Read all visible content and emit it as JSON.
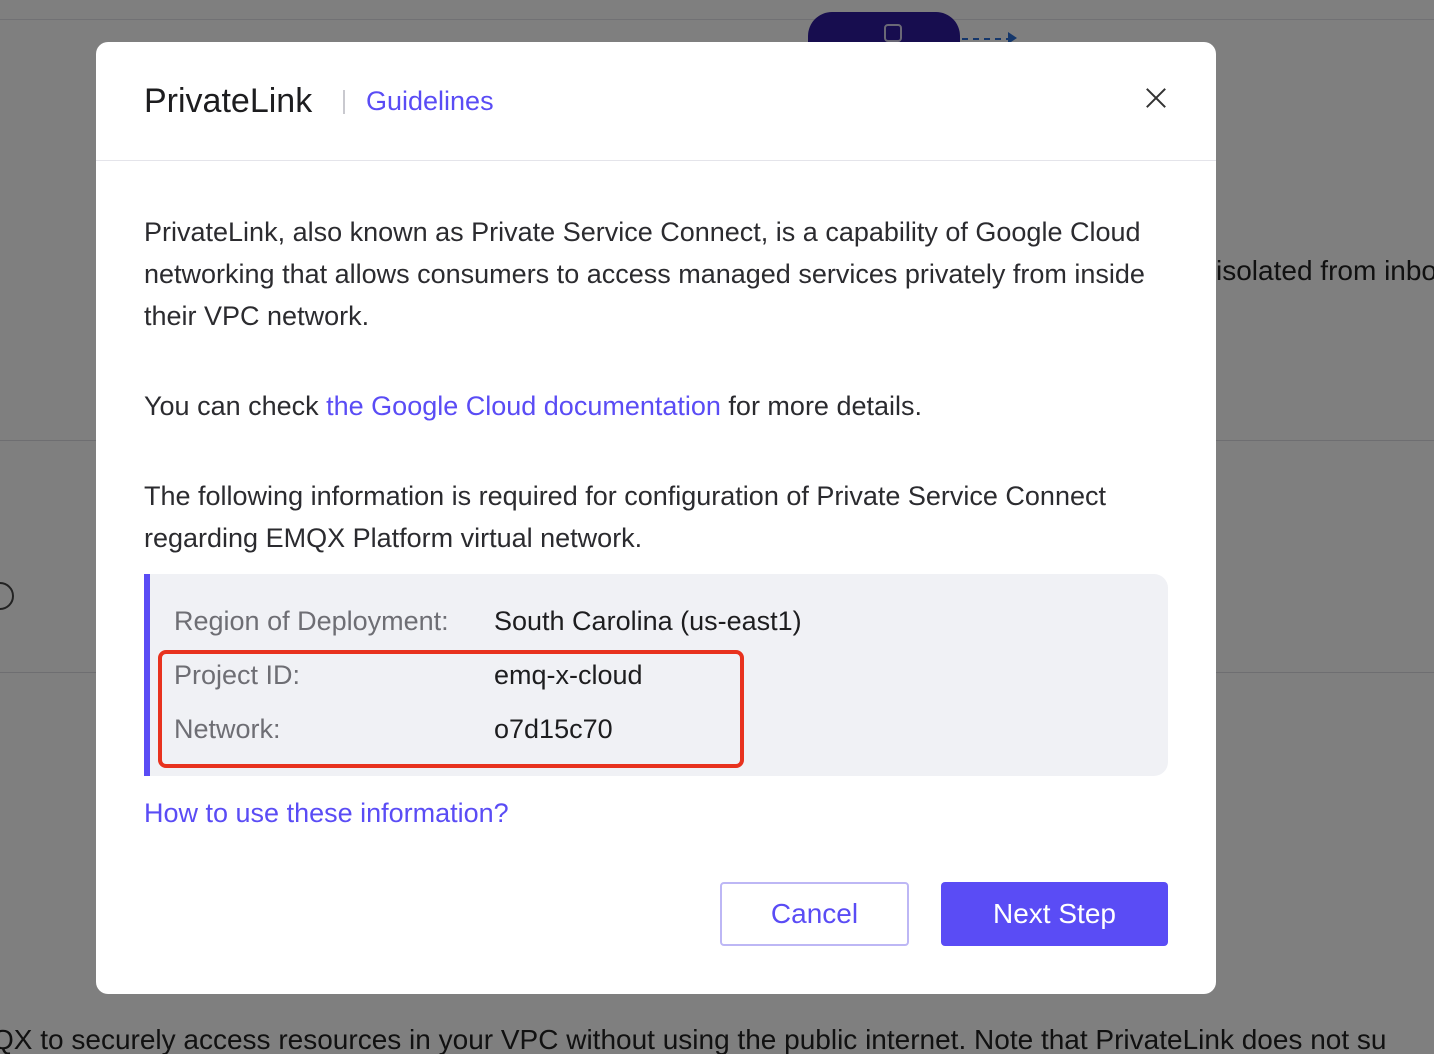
{
  "background": {
    "right_text": "isolated from inbo",
    "bottom_text": "QX to securely access resources in your VPC without using the public internet. Note that PrivateLink does not su"
  },
  "dialog": {
    "title": "PrivateLink",
    "guidelines_label": "Guidelines",
    "intro_text": "PrivateLink, also known as Private Service Connect, is a capability of Google Cloud networking that allows consumers to access managed services privately from inside their VPC network.",
    "check_prefix": "You can check ",
    "check_link": "the Google Cloud documentation",
    "check_suffix": " for more details.",
    "config_text": "The following information is required for configuration of Private Service Connect regarding EMQX Platform virtual network.",
    "info": {
      "region_label": "Region of Deployment:",
      "region_value": "South Carolina (us-east1)",
      "project_label": "Project ID:",
      "project_value": "emq-x-cloud",
      "network_label": "Network:",
      "network_value": "o7d15c70"
    },
    "howto_link": "How to use these information?",
    "cancel_label": "Cancel",
    "next_label": "Next Step"
  },
  "colors": {
    "accent": "#5a4cf5",
    "highlight": "#e8321e"
  }
}
